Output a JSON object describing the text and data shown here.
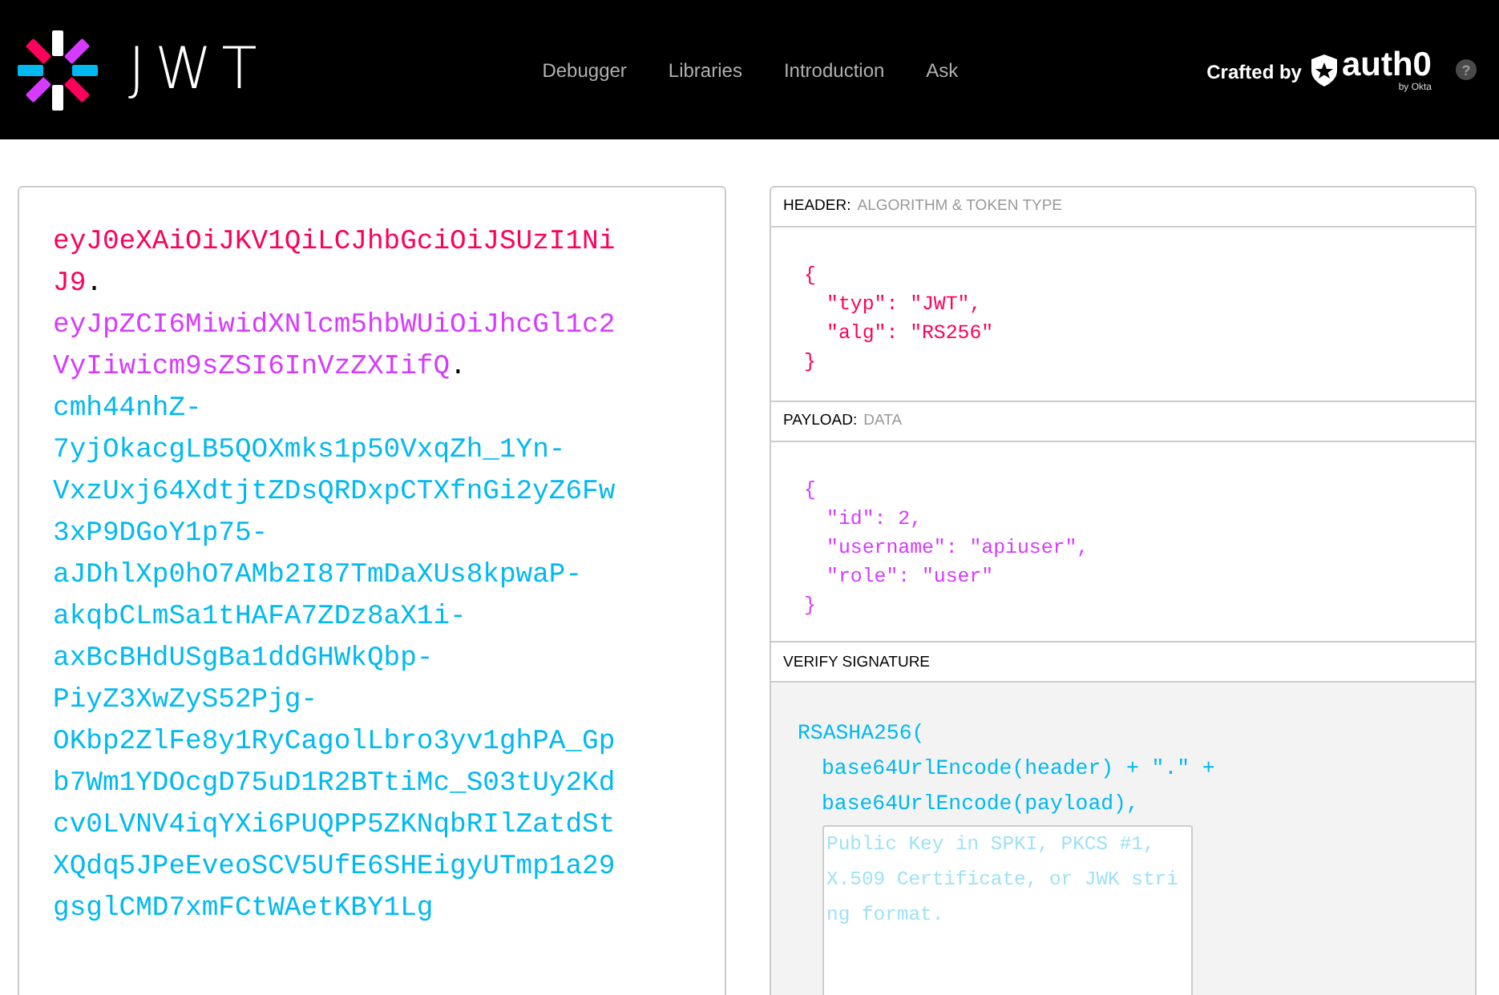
{
  "topbar": {
    "logo_text": "JWT",
    "nav": [
      "Debugger",
      "Libraries",
      "Introduction",
      "Ask"
    ],
    "crafted_by": "Crafted by",
    "brand": "auth0",
    "brand_sub": "by Okta",
    "help": "?"
  },
  "encoded": {
    "separator": ".",
    "parts": [
      {
        "kind": "header",
        "text": "eyJ0eXAiOiJKV1QiLCJhbGciOiJSUzI1NiJ9"
      },
      {
        "kind": "payload",
        "text": "eyJpZCI6MiwidXNlcm5hbWUiOiJhcGl1c2VyIiwicm9sZSI6InVzZXIifQ"
      },
      {
        "kind": "signature",
        "text": "cmh44nhZ-7yjOkacgLB5QOXmks1p50VxqZh_1Yn-VxzUxj64XdtjtZDsQRDxpCTXfnGi2yZ6Fw3xP9DGoY1p75-aJDhlXp0hO7AMb2I87TmDaXUs8kpwaP-akqbCLmSa1tHAFA7ZDz8aX1i-axBcBHdUSgBa1ddGHWkQbp-PiyZ3XwZyS52Pjg-OKbp2ZlFe8y1RyCagolLbro3yv1ghPA_Gpb7Wm1YDOcgD75uD1R2BTtiMc_S03tUy2Kdcv0LVNV4iqYXi6PUQPP5ZKNqbRIlZatdStXQdq5JPeEveoSCV5UfE6SHEigyUTmp1a29gsglCMD7xmFCtWAetKBY1Lg"
      }
    ]
  },
  "decoded": {
    "sections": [
      {
        "kind": "header",
        "title": "HEADER:",
        "subtitle": "ALGORITHM & TOKEN TYPE",
        "lines": [
          {
            "kind": "brace",
            "text": "{"
          },
          {
            "kind": "entry",
            "text": "\"typ\": \"JWT\","
          },
          {
            "kind": "entry",
            "text": "\"alg\": \"RS256\""
          },
          {
            "kind": "brace",
            "text": "}"
          }
        ]
      },
      {
        "kind": "payload",
        "title": "PAYLOAD:",
        "subtitle": "DATA",
        "lines": [
          {
            "kind": "brace",
            "text": "{"
          },
          {
            "kind": "entry",
            "text": "\"id\": 2,"
          },
          {
            "kind": "entry",
            "text": "\"username\": \"apiuser\","
          },
          {
            "kind": "entry",
            "text": "\"role\": \"user\""
          },
          {
            "kind": "brace",
            "text": "}"
          }
        ]
      },
      {
        "kind": "verify",
        "title": "VERIFY SIGNATURE",
        "lines": [
          {
            "kind": "brace",
            "text": "RSASHA256("
          },
          {
            "kind": "entry",
            "text": "base64UrlEncode(header) + \".\" +"
          },
          {
            "kind": "entry",
            "text": "base64UrlEncode(payload),"
          }
        ],
        "key_field": {
          "placeholder": "Public Key in SPKI, PKCS #1, X.509 Certificate, or JWK string format."
        }
      }
    ]
  }
}
